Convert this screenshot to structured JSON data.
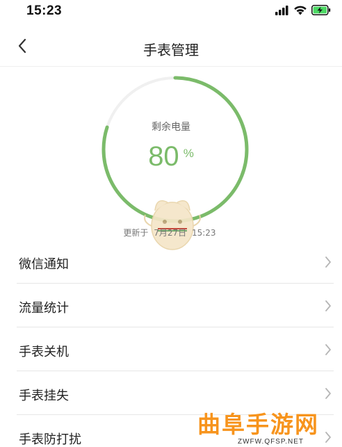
{
  "status_bar": {
    "time": "15:23",
    "icons": [
      "signal-icon",
      "wifi-icon",
      "battery-charging-icon"
    ]
  },
  "nav": {
    "title": "手表管理",
    "back_icon": "chevron-left-icon"
  },
  "battery": {
    "label": "剩余电量",
    "value": "80",
    "unit": "%",
    "level": 0.8,
    "updated_prefix": "更新于",
    "updated_date": "7月27日",
    "updated_time": "15:23",
    "ring_color": "#7bbb6a",
    "track_color": "#f0f0f0"
  },
  "menu": {
    "items": [
      {
        "label": "微信通知"
      },
      {
        "label": "流量统计"
      },
      {
        "label": "手表关机"
      },
      {
        "label": "手表挂失"
      },
      {
        "label": "手表防打扰"
      }
    ]
  },
  "watermark": {
    "title": "曲阜手游网",
    "url": "ZWFW.QFSP.NET",
    "color": "#f7941d"
  }
}
